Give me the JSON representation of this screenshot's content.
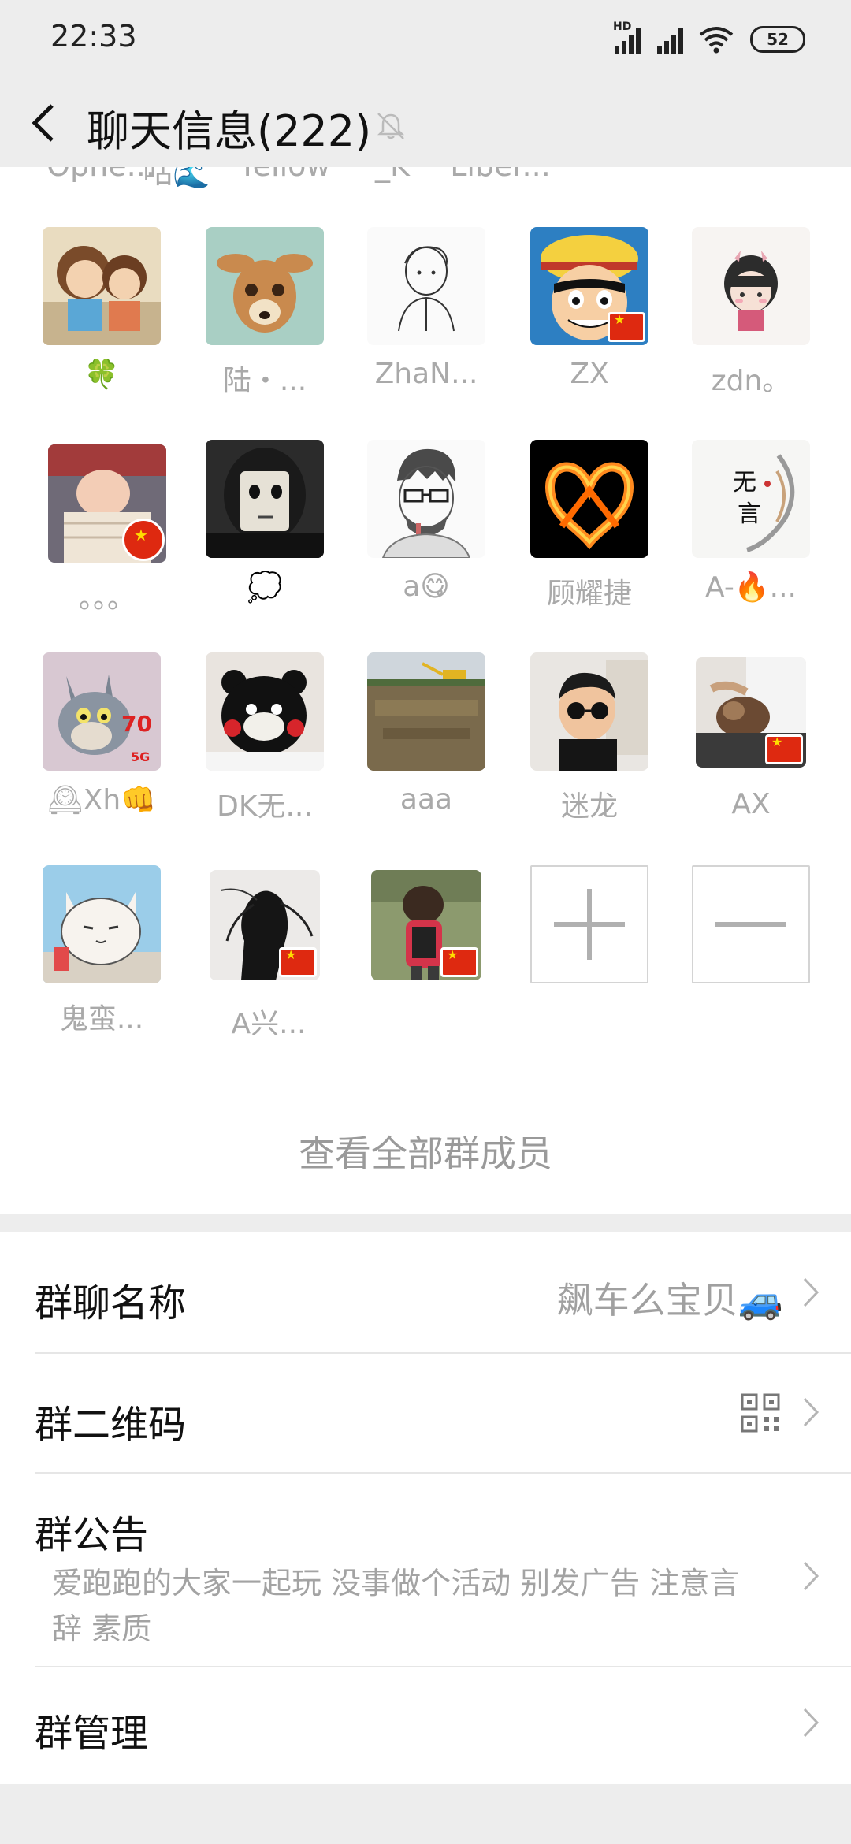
{
  "status_bar": {
    "time": "22:33",
    "hd": "HD",
    "battery": "52"
  },
  "nav": {
    "title": "聊天信息(222)"
  },
  "partial_row": [
    "Ophe...",
    "咕🌊",
    "Yellow",
    "_K",
    "Liber..."
  ],
  "members": [
    {
      "name": "🍀"
    },
    {
      "name": "陆・..."
    },
    {
      "name": "ZhaN..."
    },
    {
      "name": "ZX"
    },
    {
      "name": "zdn。"
    },
    {
      "name": "。。。"
    },
    {
      "name": "💭"
    },
    {
      "name": "a😋"
    },
    {
      "name": "顾耀捷"
    },
    {
      "name": "A-🔥..."
    },
    {
      "name": "🕰Xh👊"
    },
    {
      "name": "DK无..."
    },
    {
      "name": "aaa"
    },
    {
      "name": "迷龙"
    },
    {
      "name": "AX"
    },
    {
      "name": "鬼蛮..."
    },
    {
      "name": "A兴..."
    },
    {
      "name": ""
    }
  ],
  "avatar_text": {
    "kanji_1": "无",
    "kanji_2": "言",
    "cat_badge": "70",
    "cat_5g": "5G"
  },
  "view_all": "查看全部群成员",
  "settings": {
    "group_name_label": "群聊名称",
    "group_name_value": "飙车么宝贝🚙",
    "qr_label": "群二维码",
    "notice_label": "群公告",
    "notice_text": "爱跑跑的大家一起玩 没事做个活动 别发广告 注意言辞 素质",
    "manage_label": "群管理"
  },
  "icons": {
    "back": "chevron-left-icon",
    "mute": "bell-slash-icon",
    "add": "plus-icon",
    "remove": "minus-icon",
    "qr": "qr-code-icon",
    "chevron": "chevron-right-icon"
  },
  "colors": {
    "background": "#ededed",
    "panel": "#ffffff",
    "muted_text": "#a9a9a9",
    "flag_red": "#de2910"
  }
}
